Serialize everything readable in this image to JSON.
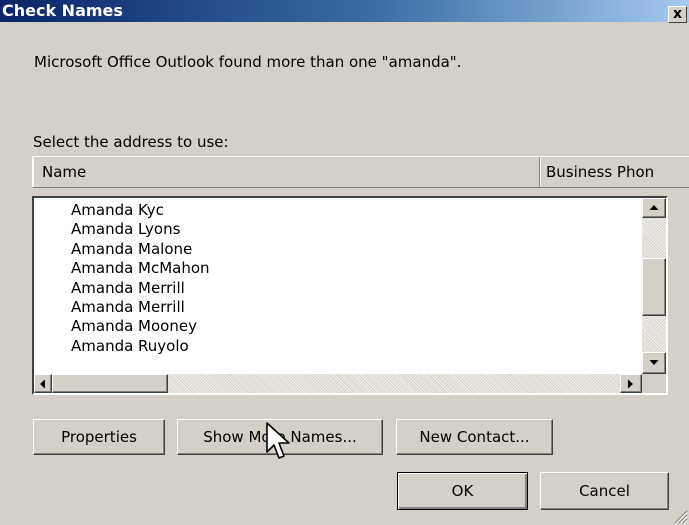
{
  "window": {
    "title": "Check Names",
    "close_glyph": "x"
  },
  "message": "Microsoft Office Outlook found more than one \"amanda\".",
  "select_label": "Select the address to use:",
  "columns": [
    "Name",
    "Business Phon"
  ],
  "names": [
    "Amanda Kyc",
    "Amanda Lyons",
    "Amanda Malone",
    "Amanda McMahon",
    "Amanda Merrill",
    "Amanda Merrill",
    "Amanda Mooney",
    "Amanda Ruyolo"
  ],
  "buttons": {
    "properties": "Properties",
    "show_more": "Show More Names...",
    "new_contact": "New Contact...",
    "ok": "OK",
    "cancel": "Cancel"
  },
  "colors": {
    "title_start": "#0a246a",
    "title_end": "#a6caf0",
    "face": "#d4d0c8"
  },
  "icons": {
    "close": "close-icon",
    "scroll_up": "arrow-up-icon",
    "scroll_down": "arrow-down-icon",
    "scroll_left": "arrow-left-icon",
    "scroll_right": "arrow-right-icon",
    "cursor": "mouse-pointer-icon",
    "grip": "resize-grip-icon"
  }
}
